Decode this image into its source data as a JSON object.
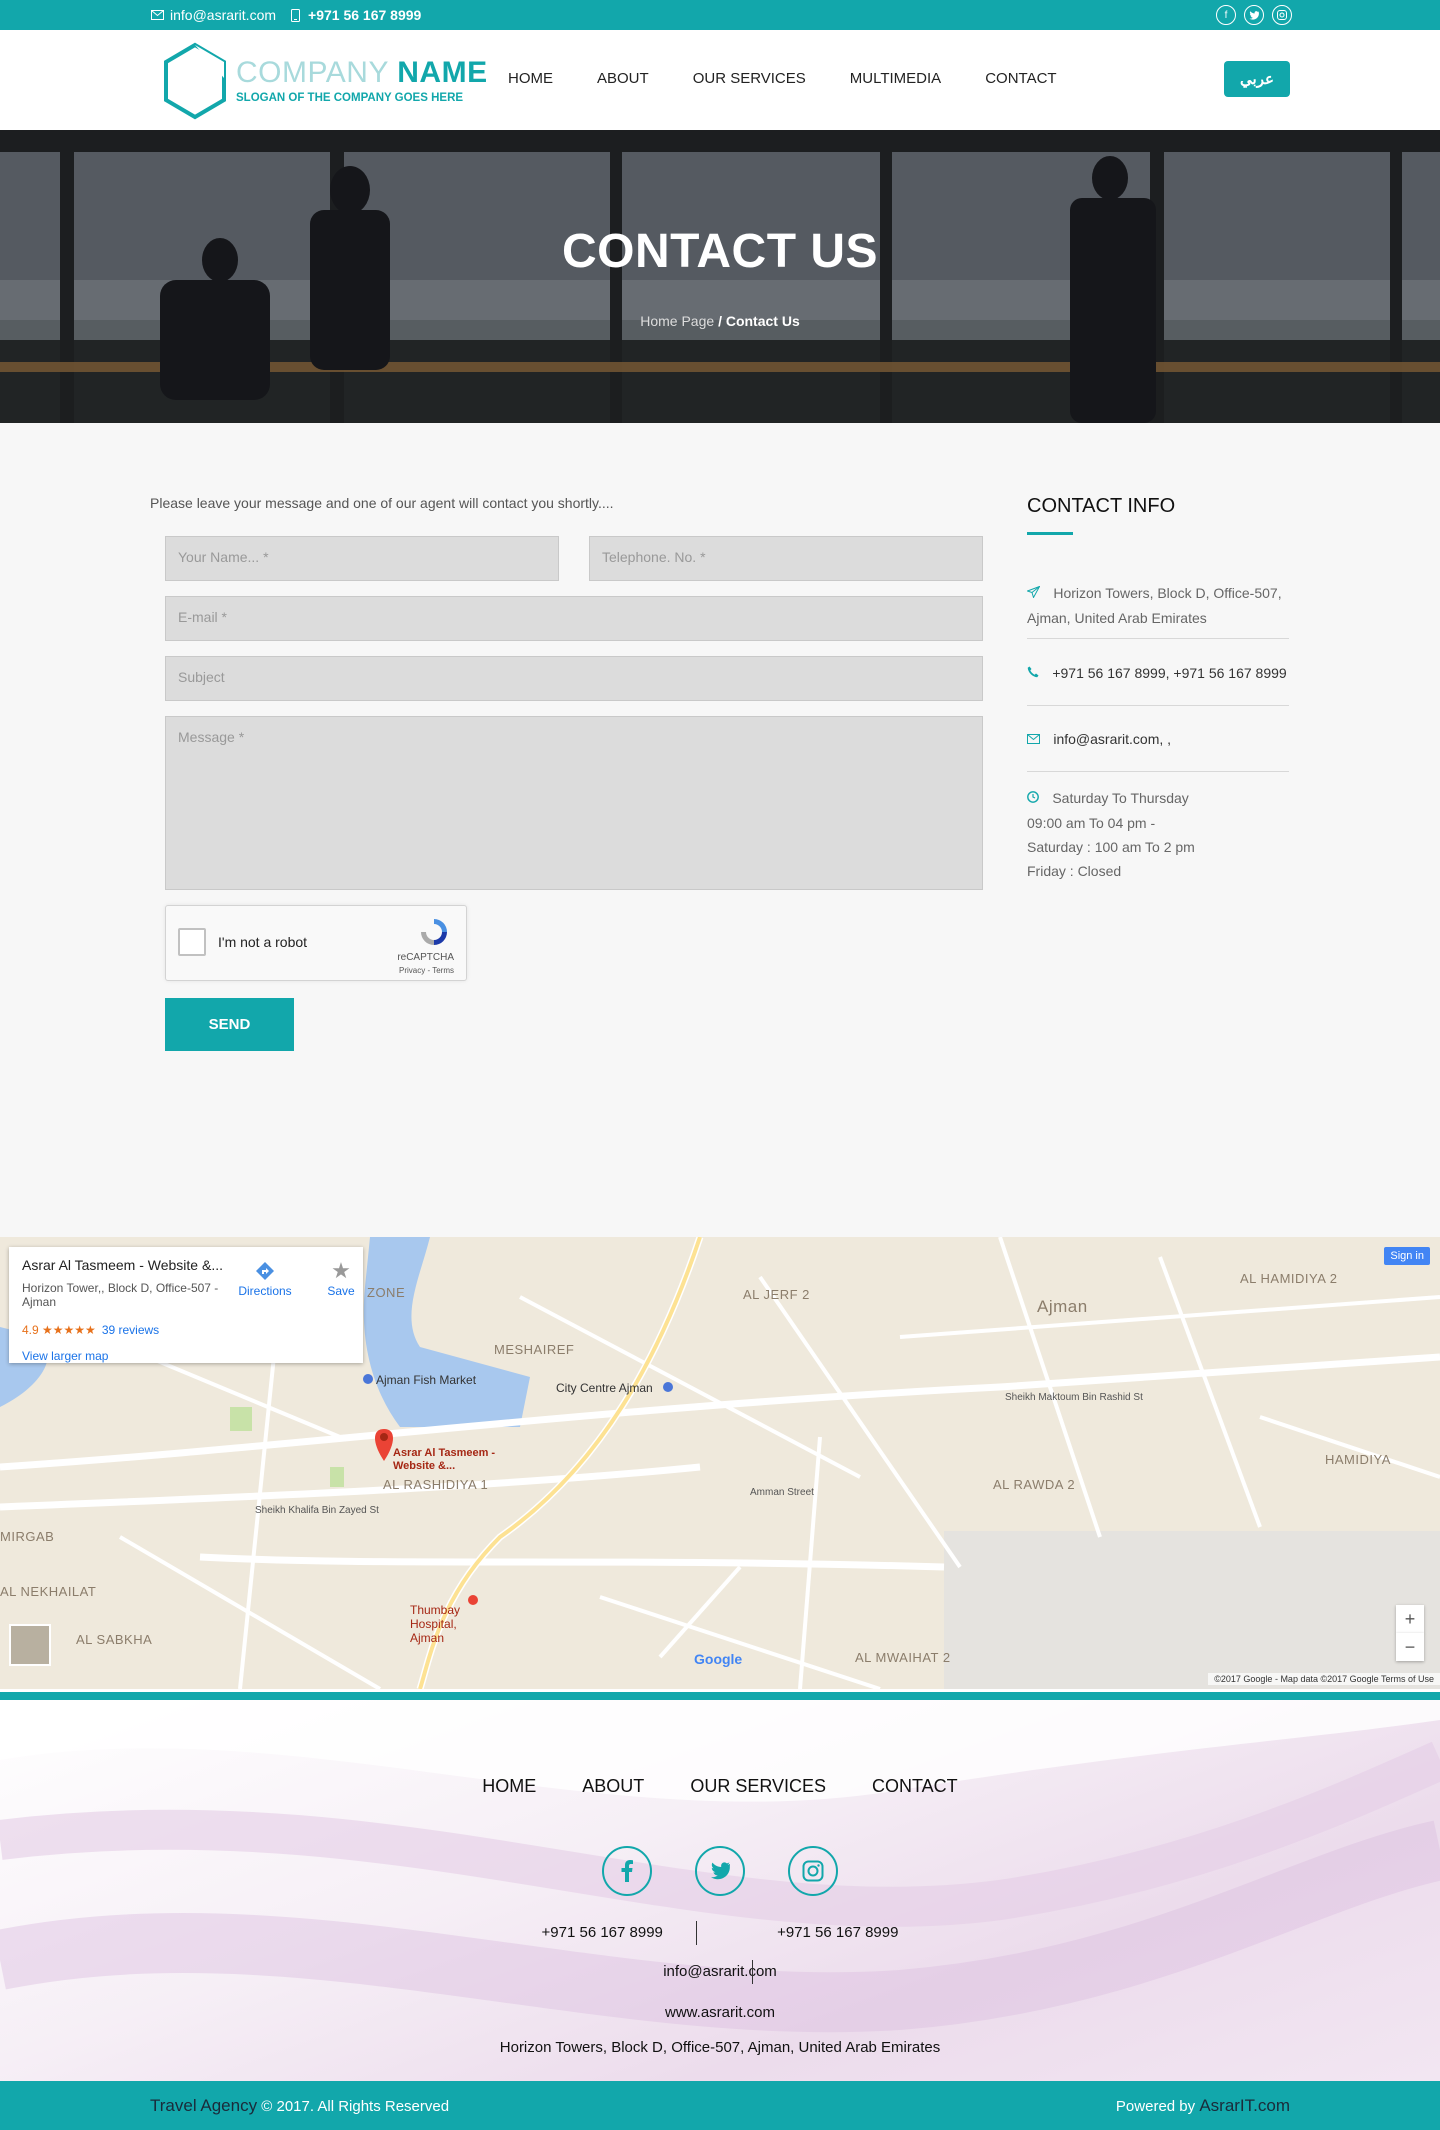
{
  "topbar": {
    "email": "info@asrarit.com",
    "phone": "+971 56 167 8999",
    "icons": [
      "envelope-icon",
      "mobile-icon",
      "facebook-icon",
      "twitter-icon",
      "instagram-icon"
    ]
  },
  "header": {
    "logo_company": "COMPANY",
    "logo_name": "NAME",
    "logo_slogan": "SLOGAN OF THE COMPANY GOES HERE",
    "nav": [
      "HOME",
      "ABOUT",
      "OUR SERVICES",
      "MULTIMEDIA",
      "CONTACT"
    ],
    "lang_button": "عربي"
  },
  "hero": {
    "title": "CONTACT US",
    "breadcrumb_home": "Home Page",
    "breadcrumb_current": "/ Contact Us"
  },
  "form": {
    "intro": "Please leave your message and one of our agent will contact you shortly....",
    "name_placeholder": "Your Name... *",
    "phone_placeholder": "Telephone. No. *",
    "email_placeholder": "E-mail *",
    "subject_placeholder": "Subject",
    "message_placeholder": "Message *",
    "captcha_label": "I'm not a robot",
    "captcha_brand": "reCAPTCHA",
    "captcha_links": "Privacy - Terms",
    "send_label": "SEND"
  },
  "contact_info": {
    "title": "CONTACT INFO",
    "address_line1": "Horizon Towers, Block D, Office-507,",
    "address_line2": "Ajman, United Arab Emirates",
    "phones": "+971 56 167 8999, +971 56 167 8999",
    "email": "info@asrarit.com, ,",
    "hours_title": "Saturday To Thursday",
    "hours_1": "09:00 am To 04 pm -",
    "hours_2": "Saturday : 100 am To 2 pm",
    "hours_3": "Friday : Closed"
  },
  "map": {
    "place_name": "Asrar Al Tasmeem - Website &...",
    "place_address": "Horizon Tower,, Block D, Office-507 - Ajman",
    "rating": "4.9 ★★★★★",
    "reviews": "39 reviews",
    "larger_map": "View larger map",
    "directions": "Directions",
    "save": "Save",
    "sign_in": "Sign in",
    "footer": "©2017 Google - Map data ©2017 Google    Terms of Use",
    "labels": {
      "marker": "Asrar Al Tasmeem - Website &...",
      "fish_market": "Ajman Fish Market",
      "city_centre": "City Centre Ajman",
      "meshaireef": "MESHAIREF",
      "al_jerf": "AL JERF 2",
      "ajman": "Ajman",
      "al_hamidiya": "AL HAMIDIYA 2",
      "al_rashidiya": "AL RASHIDIYA 1",
      "al_rawda": "AL RAWDA 2",
      "al_nekhailat": "AL NEKHAILAT",
      "al_sabkha": "AL SABKHA",
      "thumbay": "Thumbay Hospital, Ajman",
      "mirgab": "MIRGAB",
      "al_mwaihat": "AL MWAIHAT 2",
      "hamidiya": "HAMIDIYA",
      "zone": "ZONE",
      "sheikh_maktoum": "Sheikh Maktoum Bin Rashid St",
      "sheikh_khalifa": "Sheikh Khalifa Bin Zayed St",
      "amman_street": "Amman Street",
      "google": "Google"
    }
  },
  "footer": {
    "nav": [
      "HOME",
      "ABOUT",
      "OUR SERVICES",
      "CONTACT"
    ],
    "phone1": "+971 56 167 8999",
    "phone2": "+971 56 167 8999",
    "email": "info@asrarit.com",
    "website": "www.asrarit.com",
    "address": "Horizon Towers, Block D, Office-507, Ajman, United Arab Emirates",
    "copyright_brand": "Travel Agency",
    "copyright_text": "© 2017. All Rights Reserved",
    "powered_label": "Powered by",
    "powered_brand": "AsrarIT.com"
  },
  "colors": {
    "accent": "#12a7ab",
    "hero_dark": "#2a2b2d"
  }
}
